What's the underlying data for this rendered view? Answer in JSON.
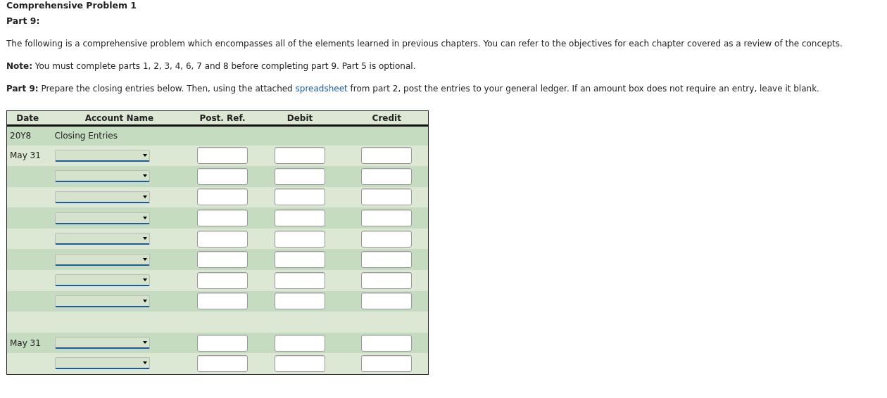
{
  "title": "Comprehensive Problem 1",
  "subtitle": "Part 9:",
  "intro": "The following is a comprehensive problem which encompasses all of the elements learned in previous chapters. You can refer to the objectives for each chapter covered as a review of the concepts.",
  "note": "**Note:**  You must complete parts 1, 2, 3, 4, 6, 7 and 8 before completing part 9. Part 5 is optional.",
  "instruction": {
    "before": "**Part 9:**  Prepare the closing entries below. Then, using the attached ",
    "link": "spreadsheet",
    "after": " from part 2, post the entries to your general ledger. If an amount box does not require an entry, leave it blank."
  },
  "table": {
    "columns": [
      "Date",
      "Account Name",
      "Post. Ref.",
      "Debit",
      "Credit"
    ],
    "rows": [
      {
        "kind": "heading",
        "date": "20Y8",
        "text": "Closing Entries"
      },
      {
        "kind": "entry",
        "date": "May 31"
      },
      {
        "kind": "entry"
      },
      {
        "kind": "entry"
      },
      {
        "kind": "entry"
      },
      {
        "kind": "entry"
      },
      {
        "kind": "entry"
      },
      {
        "kind": "entry"
      },
      {
        "kind": "entry"
      },
      {
        "kind": "blank"
      },
      {
        "kind": "entry",
        "date": "May 31"
      },
      {
        "kind": "entry"
      }
    ]
  }
}
